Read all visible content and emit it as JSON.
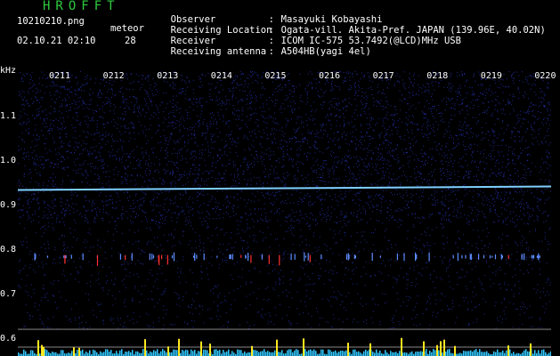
{
  "header": {
    "brand": "HROFFT",
    "filename": "10210210.png",
    "datetime": "02.10.21 02:10",
    "meteor_label": "meteor",
    "meteor_count": "28"
  },
  "station": [
    {
      "key": "Observer",
      "value": "Masayuki Kobayashi"
    },
    {
      "key": "Receiving Location",
      "value": "Ogata-vill. Akita-Pref. JAPAN (139.96E, 40.02N)"
    },
    {
      "key": "Receiver",
      "value": "ICOM IC-575 53.7492(@LCD)MHz USB"
    },
    {
      "key": "Receiving antenna",
      "value": "A504HB(yagi 4el)"
    }
  ],
  "axis": {
    "unit": "kHz",
    "time_labels": [
      "0211",
      "0212",
      "0213",
      "0214",
      "0215",
      "0216",
      "0217",
      "0218",
      "0219",
      "0220"
    ],
    "freq_labels": [
      "1.1",
      "1.0",
      "0.9",
      "0.8",
      "0.7",
      "0.6"
    ]
  },
  "colors": {
    "background": "#000000",
    "noise": "#2430a8",
    "carrier": "#7fd0ff",
    "meteor": "#ff3030",
    "activity_bars": "#ffe820",
    "activity_base": "#30c8ff",
    "brand": "#2ecc40"
  },
  "chart_data": {
    "type": "heatmap",
    "ylabel": "kHz",
    "x_ticks": [
      "0211",
      "0212",
      "0213",
      "0214",
      "0215",
      "0216",
      "0217",
      "0218",
      "0219",
      "0220"
    ],
    "y_ticks": [
      1.1,
      1.0,
      0.9,
      0.8,
      0.7,
      0.6
    ],
    "carrier_khz": 0.935,
    "meteor_band_khz": 0.775
  }
}
